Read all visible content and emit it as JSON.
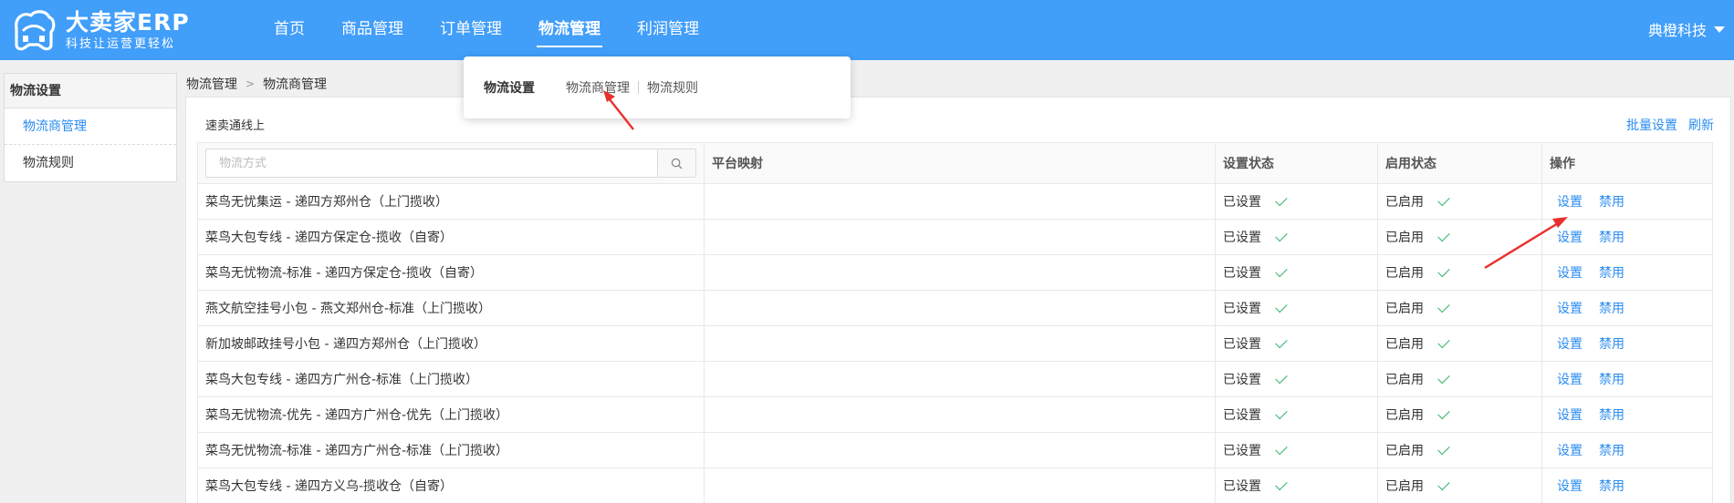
{
  "app": {
    "title": "大卖家ERP",
    "slogan": "科技让运营更轻松",
    "company": "典橙科技"
  },
  "nav": [
    {
      "label": "首页"
    },
    {
      "label": "商品管理"
    },
    {
      "label": "订单管理"
    },
    {
      "label": "物流管理"
    },
    {
      "label": "利润管理"
    }
  ],
  "nav_active": "物流管理",
  "dropdown": {
    "heading": "物流设置",
    "links": [
      "物流商管理",
      "物流规则"
    ]
  },
  "sidebar": {
    "heading": "物流设置",
    "items": [
      {
        "label": "物流商管理",
        "active": true
      },
      {
        "label": "物流规则",
        "active": false
      }
    ]
  },
  "breadcrumb": [
    "物流管理",
    "物流商管理"
  ],
  "panel": {
    "title": "速卖通线上",
    "actions": [
      "批量设置",
      "刷新"
    ]
  },
  "search": {
    "placeholder": "物流方式",
    "icon": "search-icon"
  },
  "table": {
    "headers": [
      "平台映射",
      "设置状态",
      "启用状态",
      "操作"
    ],
    "rows": [
      {
        "name": "菜鸟无忧集运 - 递四方郑州仓（上门揽收）",
        "mapping": "",
        "set_status": "已设置",
        "enable_status": "已启用",
        "op1": "设置",
        "op2": "禁用"
      },
      {
        "name": "菜鸟大包专线 - 递四方保定仓-揽收（自寄）",
        "mapping": "",
        "set_status": "已设置",
        "enable_status": "已启用",
        "op1": "设置",
        "op2": "禁用"
      },
      {
        "name": "菜鸟无忧物流-标准 - 递四方保定仓-揽收（自寄）",
        "mapping": "",
        "set_status": "已设置",
        "enable_status": "已启用",
        "op1": "设置",
        "op2": "禁用"
      },
      {
        "name": "燕文航空挂号小包 - 燕文郑州仓-标准（上门揽收）",
        "mapping": "",
        "set_status": "已设置",
        "enable_status": "已启用",
        "op1": "设置",
        "op2": "禁用"
      },
      {
        "name": "新加坡邮政挂号小包 - 递四方郑州仓（上门揽收）",
        "mapping": "",
        "set_status": "已设置",
        "enable_status": "已启用",
        "op1": "设置",
        "op2": "禁用"
      },
      {
        "name": "菜鸟大包专线 - 递四方广州仓-标准（上门揽收）",
        "mapping": "",
        "set_status": "已设置",
        "enable_status": "已启用",
        "op1": "设置",
        "op2": "禁用"
      },
      {
        "name": "菜鸟无忧物流-优先 - 递四方广州仓-优先（上门揽收）",
        "mapping": "",
        "set_status": "已设置",
        "enable_status": "已启用",
        "op1": "设置",
        "op2": "禁用"
      },
      {
        "name": "菜鸟无忧物流-标准 - 递四方广州仓-标准（上门揽收）",
        "mapping": "",
        "set_status": "已设置",
        "enable_status": "已启用",
        "op1": "设置",
        "op2": "禁用"
      },
      {
        "name": "菜鸟大包专线 - 递四方义乌-揽收仓（自寄）",
        "mapping": "",
        "set_status": "已设置",
        "enable_status": "已启用",
        "op1": "设置",
        "op2": "禁用"
      }
    ]
  },
  "colors": {
    "topbar": "#419ef9",
    "link": "#2a8cf0",
    "check": "#33b56b",
    "annotation_arrow": "#e8302b"
  }
}
